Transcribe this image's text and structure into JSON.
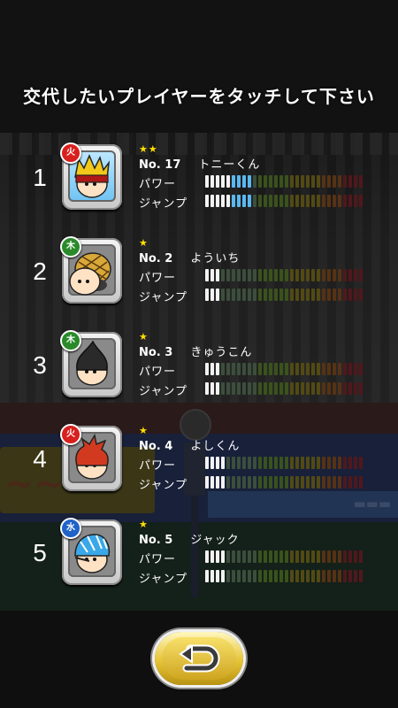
{
  "title": "交代したいプレイヤーをタッチして下さい",
  "colors": {
    "element_fire": "#d8201e",
    "element_wood": "#2a8a2a",
    "element_water": "#1f63c8",
    "star": "#ffe000",
    "bar_selected": "#5ab8f0",
    "bar_filled": "#f2f2f2"
  },
  "players": [
    {
      "rank": "1",
      "stars": "★★",
      "number": "No. 17",
      "name": "トニーくん",
      "element": "火",
      "element_color": "#d8201e",
      "hair": "crown",
      "selected": true,
      "power_label": "パワー",
      "jump_label": "ジャンプ",
      "power": 9,
      "jump": 9
    },
    {
      "rank": "2",
      "stars": "★",
      "number": "No. 2",
      "name": "よういち",
      "element": "木",
      "element_color": "#2a8a2a",
      "hair": "net",
      "selected": false,
      "power_label": "パワー",
      "jump_label": "ジャンプ",
      "power": 3,
      "jump": 3
    },
    {
      "rank": "3",
      "stars": "★",
      "number": "No. 3",
      "name": "きゅうこん",
      "element": "木",
      "element_color": "#2a8a2a",
      "hair": "bulb",
      "selected": false,
      "power_label": "パワー",
      "jump_label": "ジャンプ",
      "power": 3,
      "jump": 3
    },
    {
      "rank": "4",
      "stars": "★",
      "number": "No. 4",
      "name": "よしくん",
      "element": "火",
      "element_color": "#d8201e",
      "hair": "red",
      "selected": false,
      "power_label": "パワー",
      "jump_label": "ジャンプ",
      "power": 4,
      "jump": 4
    },
    {
      "rank": "5",
      "stars": "★",
      "number": "No. 5",
      "name": "ジャック",
      "element": "水",
      "element_color": "#1f63c8",
      "hair": "cap",
      "selected": false,
      "power_label": "パワー",
      "jump_label": "ジャンプ",
      "power": 4,
      "jump": 4
    }
  ],
  "stat_max": 30,
  "back_button": {
    "icon": "return-arrow-icon"
  }
}
